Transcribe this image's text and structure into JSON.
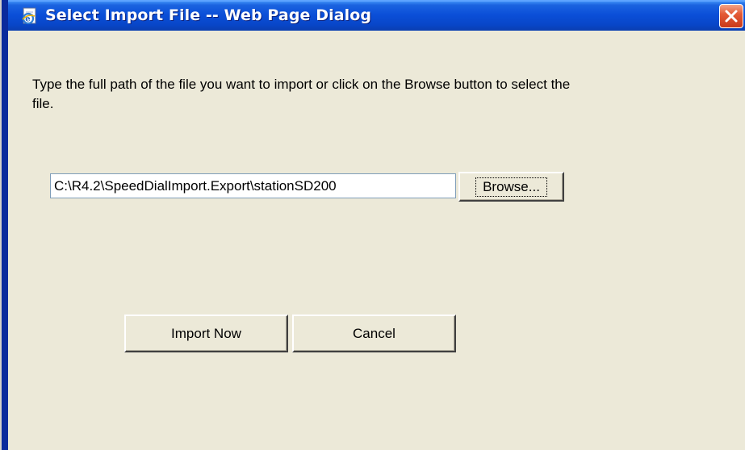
{
  "window": {
    "title": "Select Import File -- Web Page Dialog",
    "title_icon": "ie-page-icon",
    "close_icon": "close-icon",
    "titlebar_color": "#0b4fd8",
    "background_color": "#ece9d8"
  },
  "dialog": {
    "instructions": "Type the full path of the file you want to import or click on the Browse button to select the file.",
    "file_path_value": "C:\\R4.2\\SpeedDialImport.Export\\stationSD200",
    "browse_label": "Browse...",
    "import_label": "Import Now",
    "cancel_label": "Cancel"
  }
}
